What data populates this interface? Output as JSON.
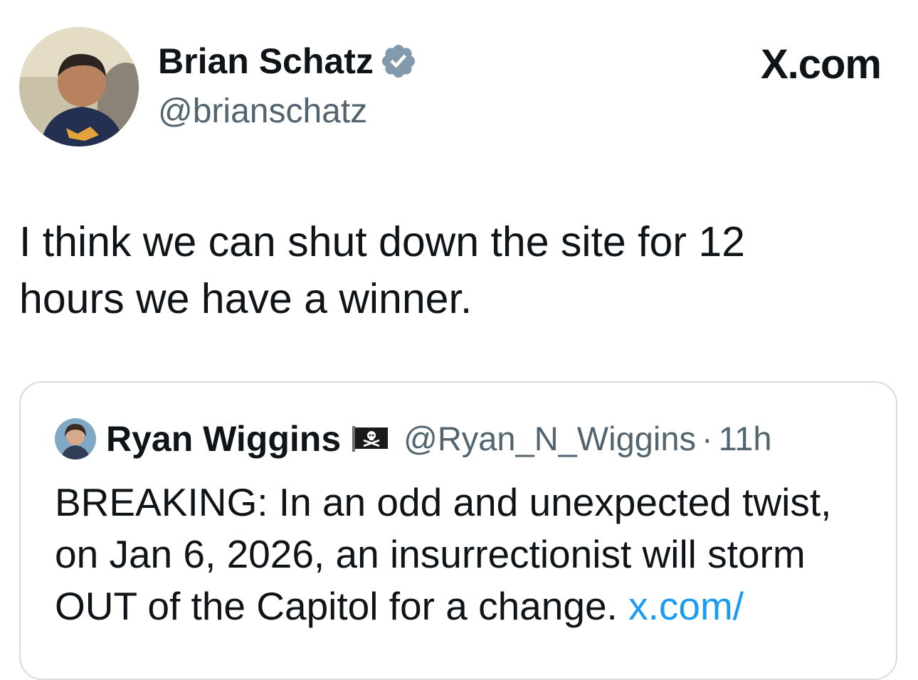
{
  "tweet": {
    "author": {
      "name": "Brian Schatz",
      "handle": "@brianschatz",
      "verified_icon": "verified-badge-icon"
    },
    "site_brand": "X.com",
    "text": "I think we can shut down the site for 12\nhours we have a winner."
  },
  "quoted_tweet": {
    "author": {
      "name": "Ryan Wiggins",
      "emoji_icon": "pirate-flag-icon",
      "handle": "@Ryan_N_Wiggins",
      "separator": "·",
      "time": "11h"
    },
    "text": "BREAKING: In an odd and unexpected twist, on Jan 6, 2026, an insurrectionist will storm OUT of the Capitol for a change. ",
    "link": "x.com/"
  },
  "colors": {
    "text_primary": "#0f1419",
    "text_secondary": "#536471",
    "link": "#1d9bf0",
    "verified_badge": "#829aab",
    "card_border": "#d5dce0"
  }
}
